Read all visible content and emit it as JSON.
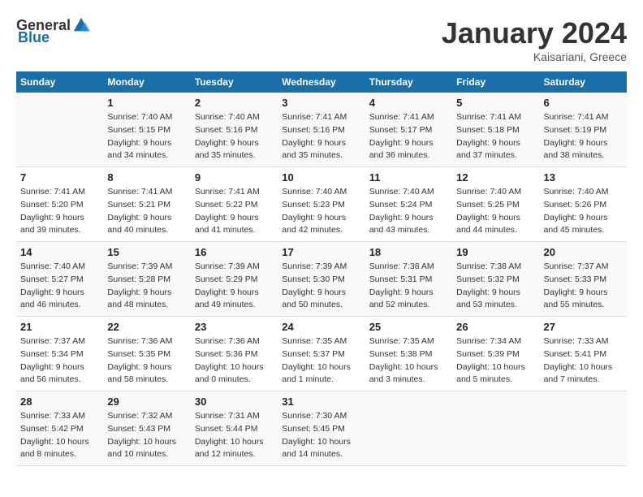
{
  "header": {
    "logo_general": "General",
    "logo_blue": "Blue",
    "month": "January 2024",
    "location": "Kaisariani, Greece"
  },
  "weekdays": [
    "Sunday",
    "Monday",
    "Tuesday",
    "Wednesday",
    "Thursday",
    "Friday",
    "Saturday"
  ],
  "weeks": [
    [
      {
        "day": "",
        "info": ""
      },
      {
        "day": "1",
        "info": "Sunrise: 7:40 AM\nSunset: 5:15 PM\nDaylight: 9 hours\nand 34 minutes."
      },
      {
        "day": "2",
        "info": "Sunrise: 7:40 AM\nSunset: 5:16 PM\nDaylight: 9 hours\nand 35 minutes."
      },
      {
        "day": "3",
        "info": "Sunrise: 7:41 AM\nSunset: 5:16 PM\nDaylight: 9 hours\nand 35 minutes."
      },
      {
        "day": "4",
        "info": "Sunrise: 7:41 AM\nSunset: 5:17 PM\nDaylight: 9 hours\nand 36 minutes."
      },
      {
        "day": "5",
        "info": "Sunrise: 7:41 AM\nSunset: 5:18 PM\nDaylight: 9 hours\nand 37 minutes."
      },
      {
        "day": "6",
        "info": "Sunrise: 7:41 AM\nSunset: 5:19 PM\nDaylight: 9 hours\nand 38 minutes."
      }
    ],
    [
      {
        "day": "7",
        "info": "Sunrise: 7:41 AM\nSunset: 5:20 PM\nDaylight: 9 hours\nand 39 minutes."
      },
      {
        "day": "8",
        "info": "Sunrise: 7:41 AM\nSunset: 5:21 PM\nDaylight: 9 hours\nand 40 minutes."
      },
      {
        "day": "9",
        "info": "Sunrise: 7:41 AM\nSunset: 5:22 PM\nDaylight: 9 hours\nand 41 minutes."
      },
      {
        "day": "10",
        "info": "Sunrise: 7:40 AM\nSunset: 5:23 PM\nDaylight: 9 hours\nand 42 minutes."
      },
      {
        "day": "11",
        "info": "Sunrise: 7:40 AM\nSunset: 5:24 PM\nDaylight: 9 hours\nand 43 minutes."
      },
      {
        "day": "12",
        "info": "Sunrise: 7:40 AM\nSunset: 5:25 PM\nDaylight: 9 hours\nand 44 minutes."
      },
      {
        "day": "13",
        "info": "Sunrise: 7:40 AM\nSunset: 5:26 PM\nDaylight: 9 hours\nand 45 minutes."
      }
    ],
    [
      {
        "day": "14",
        "info": "Sunrise: 7:40 AM\nSunset: 5:27 PM\nDaylight: 9 hours\nand 46 minutes."
      },
      {
        "day": "15",
        "info": "Sunrise: 7:39 AM\nSunset: 5:28 PM\nDaylight: 9 hours\nand 48 minutes."
      },
      {
        "day": "16",
        "info": "Sunrise: 7:39 AM\nSunset: 5:29 PM\nDaylight: 9 hours\nand 49 minutes."
      },
      {
        "day": "17",
        "info": "Sunrise: 7:39 AM\nSunset: 5:30 PM\nDaylight: 9 hours\nand 50 minutes."
      },
      {
        "day": "18",
        "info": "Sunrise: 7:38 AM\nSunset: 5:31 PM\nDaylight: 9 hours\nand 52 minutes."
      },
      {
        "day": "19",
        "info": "Sunrise: 7:38 AM\nSunset: 5:32 PM\nDaylight: 9 hours\nand 53 minutes."
      },
      {
        "day": "20",
        "info": "Sunrise: 7:37 AM\nSunset: 5:33 PM\nDaylight: 9 hours\nand 55 minutes."
      }
    ],
    [
      {
        "day": "21",
        "info": "Sunrise: 7:37 AM\nSunset: 5:34 PM\nDaylight: 9 hours\nand 56 minutes."
      },
      {
        "day": "22",
        "info": "Sunrise: 7:36 AM\nSunset: 5:35 PM\nDaylight: 9 hours\nand 58 minutes."
      },
      {
        "day": "23",
        "info": "Sunrise: 7:36 AM\nSunset: 5:36 PM\nDaylight: 10 hours\nand 0 minutes."
      },
      {
        "day": "24",
        "info": "Sunrise: 7:35 AM\nSunset: 5:37 PM\nDaylight: 10 hours\nand 1 minute."
      },
      {
        "day": "25",
        "info": "Sunrise: 7:35 AM\nSunset: 5:38 PM\nDaylight: 10 hours\nand 3 minutes."
      },
      {
        "day": "26",
        "info": "Sunrise: 7:34 AM\nSunset: 5:39 PM\nDaylight: 10 hours\nand 5 minutes."
      },
      {
        "day": "27",
        "info": "Sunrise: 7:33 AM\nSunset: 5:41 PM\nDaylight: 10 hours\nand 7 minutes."
      }
    ],
    [
      {
        "day": "28",
        "info": "Sunrise: 7:33 AM\nSunset: 5:42 PM\nDaylight: 10 hours\nand 8 minutes."
      },
      {
        "day": "29",
        "info": "Sunrise: 7:32 AM\nSunset: 5:43 PM\nDaylight: 10 hours\nand 10 minutes."
      },
      {
        "day": "30",
        "info": "Sunrise: 7:31 AM\nSunset: 5:44 PM\nDaylight: 10 hours\nand 12 minutes."
      },
      {
        "day": "31",
        "info": "Sunrise: 7:30 AM\nSunset: 5:45 PM\nDaylight: 10 hours\nand 14 minutes."
      },
      {
        "day": "",
        "info": ""
      },
      {
        "day": "",
        "info": ""
      },
      {
        "day": "",
        "info": ""
      }
    ]
  ]
}
